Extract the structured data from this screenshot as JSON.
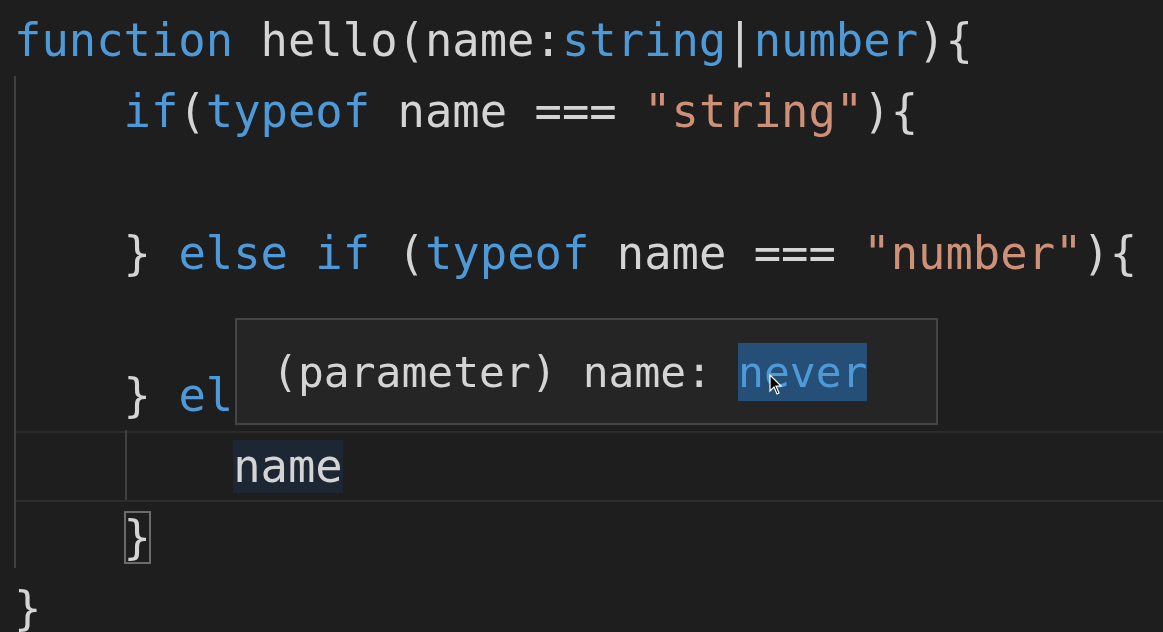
{
  "editor": {
    "lines": [
      {
        "current": false,
        "tokens": [
          {
            "text": "function",
            "kind": "keyword"
          },
          {
            "text": " hello(name:",
            "kind": "plain"
          },
          {
            "text": "string",
            "kind": "type"
          },
          {
            "text": "|",
            "kind": "plain"
          },
          {
            "text": "number",
            "kind": "type"
          },
          {
            "text": "){",
            "kind": "plain"
          }
        ]
      },
      {
        "current": false,
        "tokens": [
          {
            "text": "    if",
            "kind": "keyword"
          },
          {
            "text": "(",
            "kind": "plain"
          },
          {
            "text": "typeof",
            "kind": "keyword"
          },
          {
            "text": " name === ",
            "kind": "plain"
          },
          {
            "text": "\"string\"",
            "kind": "string"
          },
          {
            "text": "){",
            "kind": "plain"
          }
        ]
      },
      {
        "current": false
      },
      {
        "current": false,
        "tokens": [
          {
            "text": "    }",
            "kind": "plain"
          },
          {
            "text": " else if",
            "kind": "keyword"
          },
          {
            "text": " (",
            "kind": "plain"
          },
          {
            "text": "typeof",
            "kind": "keyword"
          },
          {
            "text": " name === ",
            "kind": "plain"
          },
          {
            "text": "\"number\"",
            "kind": "string"
          },
          {
            "text": "){",
            "kind": "plain"
          }
        ]
      },
      {
        "current": false
      },
      {
        "current": false,
        "tokens": [
          {
            "text": "    }",
            "kind": "plain"
          },
          {
            "text": " el",
            "kind": "keyword"
          }
        ]
      },
      {
        "current": true,
        "tokens": [
          {
            "text": "        name",
            "kind": "highlight"
          }
        ]
      },
      {
        "current": false,
        "tokens": [
          {
            "text": "    }",
            "kind": "bracket-match"
          }
        ]
      },
      {
        "current": false,
        "tokens": [
          {
            "text": "}",
            "kind": "plain"
          }
        ]
      }
    ]
  },
  "hover_tooltip": {
    "text": "(parameter) name: ",
    "type": "never"
  }
}
